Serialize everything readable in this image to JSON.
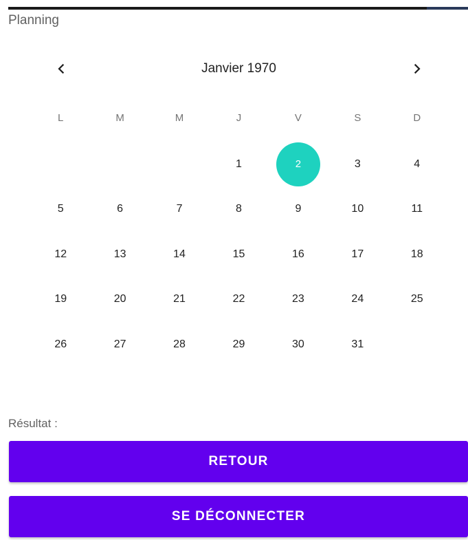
{
  "app": {
    "title": "Planning"
  },
  "calendar": {
    "month_label": "Janvier 1970",
    "prev_icon": "chevron-left-icon",
    "next_icon": "chevron-right-icon",
    "weekdays": [
      "L",
      "M",
      "M",
      "J",
      "V",
      "S",
      "D"
    ],
    "selected_day": "2",
    "selected_color": "#1ed2bf",
    "days": [
      "",
      "",
      "",
      "1",
      "2",
      "3",
      "4",
      "5",
      "6",
      "7",
      "8",
      "9",
      "10",
      "11",
      "12",
      "13",
      "14",
      "15",
      "16",
      "17",
      "18",
      "19",
      "20",
      "21",
      "22",
      "23",
      "24",
      "25",
      "26",
      "27",
      "28",
      "29",
      "30",
      "31",
      ""
    ]
  },
  "result": {
    "label": "Résultat :"
  },
  "buttons": {
    "back_label": "RETOUR",
    "logout_label": "SE DÉCONNECTER",
    "accent_color": "#6200ee"
  }
}
